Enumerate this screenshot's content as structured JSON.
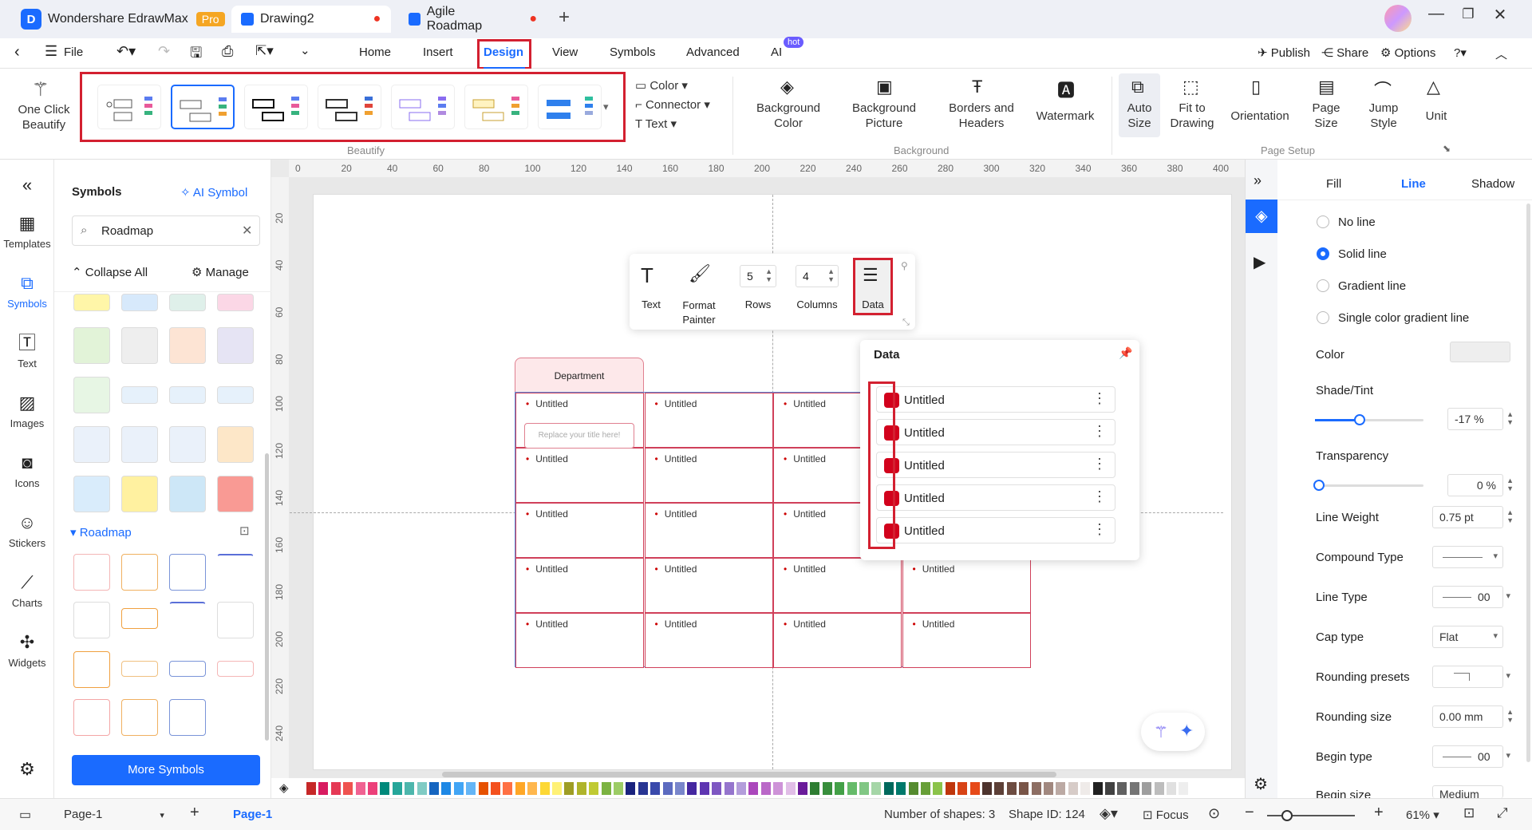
{
  "app": {
    "title": "Wondershare EdrawMax",
    "badge": "Pro"
  },
  "tabs": [
    {
      "label": "Drawing2"
    },
    {
      "label": "Agile Roadmap"
    }
  ],
  "menu": {
    "file": "File",
    "items": [
      "Home",
      "Insert",
      "Design",
      "View",
      "Symbols",
      "Advanced",
      "AI"
    ],
    "ai_badge": "hot",
    "publish": "Publish",
    "share": "Share",
    "options": "Options"
  },
  "ribbon": {
    "one_click": "One Click\nBeautify",
    "beautify_label": "Beautify",
    "color": "Color",
    "connector": "Connector",
    "text": "Text",
    "background": [
      {
        "label": "Background\nColor"
      },
      {
        "label": "Background\nPicture"
      },
      {
        "label": "Borders and\nHeaders"
      },
      {
        "label": "Watermark"
      }
    ],
    "background_group": "Background",
    "page_setup": [
      {
        "label": "Auto\nSize"
      },
      {
        "label": "Fit to\nDrawing"
      },
      {
        "label": "Orientation"
      },
      {
        "label": "Page\nSize"
      },
      {
        "label": "Jump\nStyle"
      },
      {
        "label": "Unit"
      }
    ],
    "page_setup_group": "Page Setup"
  },
  "leftbar": [
    "Templates",
    "Symbols",
    "Text",
    "Images",
    "Icons",
    "Stickers",
    "Charts",
    "Widgets"
  ],
  "symbols": {
    "title": "Symbols",
    "ai_symbol": "AI Symbol",
    "search_value": "Roadmap",
    "collapse_all": "Collapse All",
    "manage": "Manage",
    "section": "Roadmap",
    "more": "More Symbols"
  },
  "ruler": {
    "h": [
      "0",
      "20",
      "40",
      "60",
      "80",
      "100",
      "120",
      "140",
      "160",
      "180",
      "200",
      "220",
      "240",
      "260",
      "280",
      "300",
      "320",
      "340",
      "360",
      "380",
      "400"
    ],
    "v": [
      "20",
      "40",
      "60",
      "80",
      "100",
      "120",
      "140",
      "160",
      "180",
      "200",
      "220",
      "240"
    ]
  },
  "table": {
    "header": "Department",
    "cell": "Untitled",
    "title_placeholder": "Replace your title here!"
  },
  "floatbar": {
    "text": "Text",
    "format_painter": "Format\nPainter",
    "rows_value": "5",
    "rows": "Rows",
    "columns_value": "4",
    "columns": "Columns",
    "data": "Data"
  },
  "datapanel": {
    "title": "Data",
    "items": [
      "Untitled",
      "Untitled",
      "Untitled",
      "Untitled",
      "Untitled"
    ]
  },
  "rightpanel": {
    "tabs": [
      "Fill",
      "Line",
      "Shadow"
    ],
    "line_options": [
      "No line",
      "Solid line",
      "Gradient line",
      "Single color gradient line"
    ],
    "color": "Color",
    "shade": "Shade/Tint",
    "shade_value": "-17 %",
    "transparency": "Transparency",
    "transparency_value": "0 %",
    "line_weight": "Line Weight",
    "line_weight_value": "0.75 pt",
    "compound_type": "Compound Type",
    "line_type": "Line Type",
    "line_type_value": "00",
    "cap_type": "Cap type",
    "cap_type_value": "Flat",
    "rounding_presets": "Rounding presets",
    "rounding_size": "Rounding size",
    "rounding_size_value": "0.00 mm",
    "begin_type": "Begin type",
    "begin_type_value": "00",
    "begin_size": "Begin size",
    "begin_size_value": "Medium"
  },
  "status": {
    "page_select": "Page-1",
    "page_tab": "Page-1",
    "shapes": "Number of shapes: 3",
    "shape_id": "Shape ID: 124",
    "focus": "Focus",
    "zoom": "61%"
  },
  "colors": {
    "accent": "#1a6bff",
    "highlight": "#d32030",
    "data_swatch": "#d2021c"
  }
}
